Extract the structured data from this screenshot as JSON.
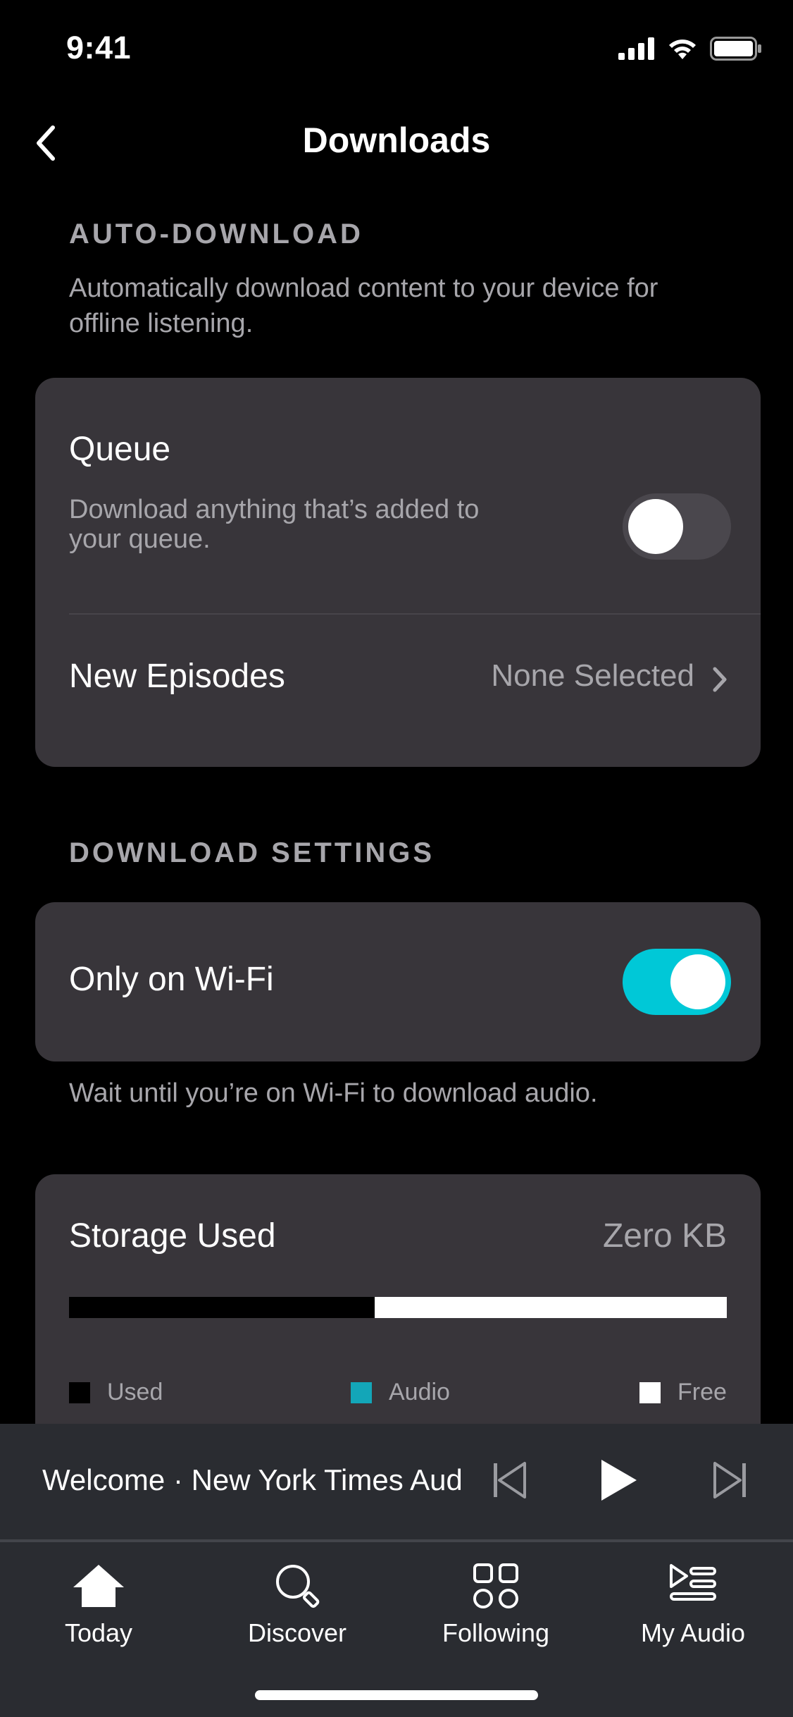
{
  "status_bar": {
    "time": "9:41"
  },
  "nav": {
    "title": "Downloads"
  },
  "auto_download": {
    "header": "AUTO-DOWNLOAD",
    "description": "Automatically download content to your device for offline listening.",
    "queue": {
      "title": "Queue",
      "subtitle": "Download anything that’s added to your queue.",
      "enabled": false
    },
    "new_episodes": {
      "title": "New Episodes",
      "value": "None Selected"
    }
  },
  "download_settings": {
    "header": "DOWNLOAD SETTINGS",
    "wifi_only": {
      "title": "Only on Wi-Fi",
      "enabled": true
    },
    "wifi_note": "Wait until you’re on Wi-Fi to download audio."
  },
  "storage": {
    "title": "Storage Used",
    "value": "Zero KB",
    "used_fraction": 0.465,
    "legend": [
      {
        "label": "Used",
        "color": "#000000"
      },
      {
        "label": "Audio",
        "color": "#13a6b8"
      },
      {
        "label": "Free",
        "color": "#ffffff"
      }
    ]
  },
  "mini_player": {
    "title": "Welcome · New York Times Audio"
  },
  "tabs": [
    {
      "label": "Today",
      "icon": "home-icon"
    },
    {
      "label": "Discover",
      "icon": "search-icon"
    },
    {
      "label": "Following",
      "icon": "grid-icon"
    },
    {
      "label": "My Audio",
      "icon": "my-audio-icon"
    }
  ],
  "colors": {
    "accent": "#00c8d7",
    "card": "#38353a",
    "toggle_off": "#4a474d"
  }
}
